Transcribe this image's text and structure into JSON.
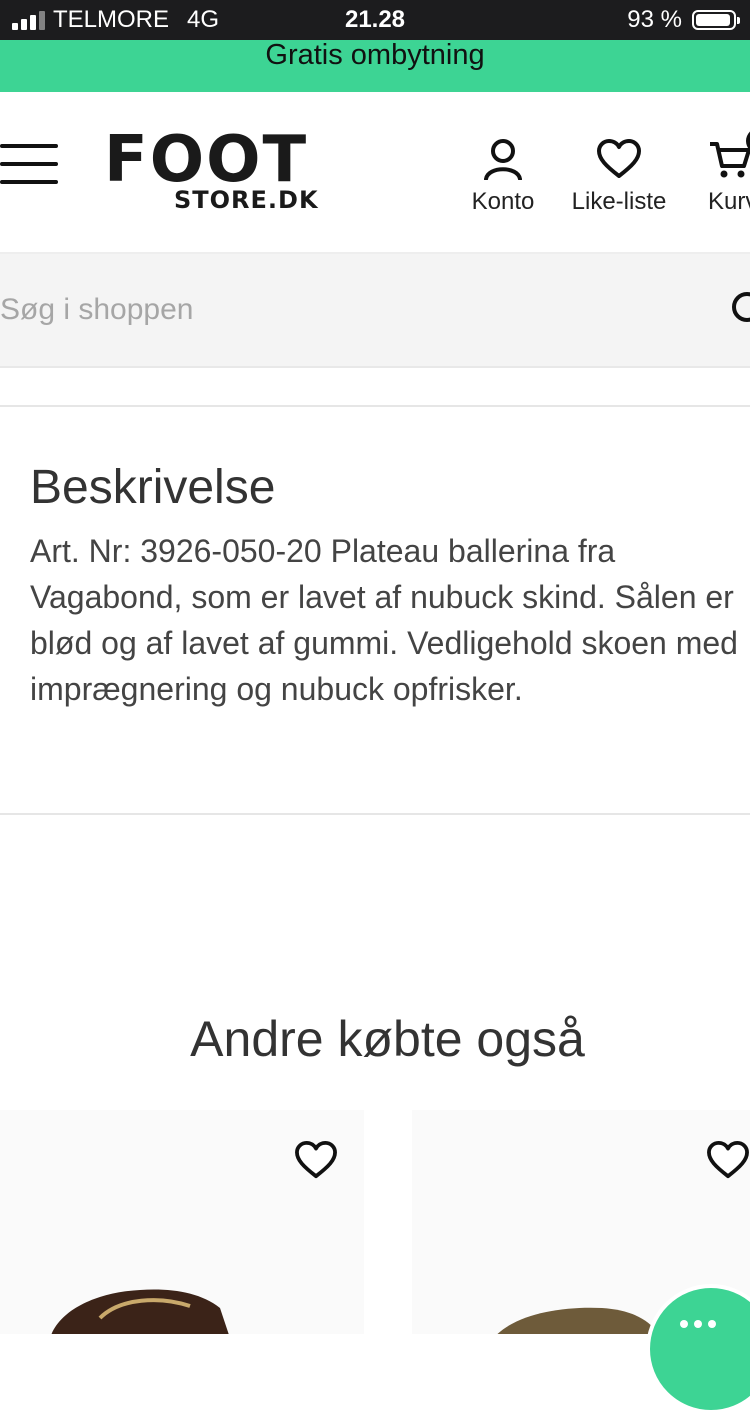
{
  "status_bar": {
    "carrier": "TELMORE",
    "network": "4G",
    "time": "21.28",
    "battery": "93 %"
  },
  "promo_banner": {
    "text": "Gratis ombytning"
  },
  "header": {
    "logo_main": "FOOT",
    "logo_sub": "STORE.DK",
    "account_label": "Konto",
    "wishlist_label": "Like-liste",
    "cart_label": "Kurv"
  },
  "search": {
    "placeholder": "Søg i shoppen",
    "value": ""
  },
  "description": {
    "title": "Beskrivelse",
    "body": "Art. Nr: 3926-050-20 Plateau ballerina fra Vagabond, som er lavet af nubuck skind. Sålen er blød og af lavet af gummi. Vedligehold skoen med imprægnering og nubuck opfrisker."
  },
  "related": {
    "title": "Andre købte også"
  },
  "colors": {
    "accent": "#3dd494",
    "status_bar": "#1c1c1e",
    "text": "#333333"
  }
}
